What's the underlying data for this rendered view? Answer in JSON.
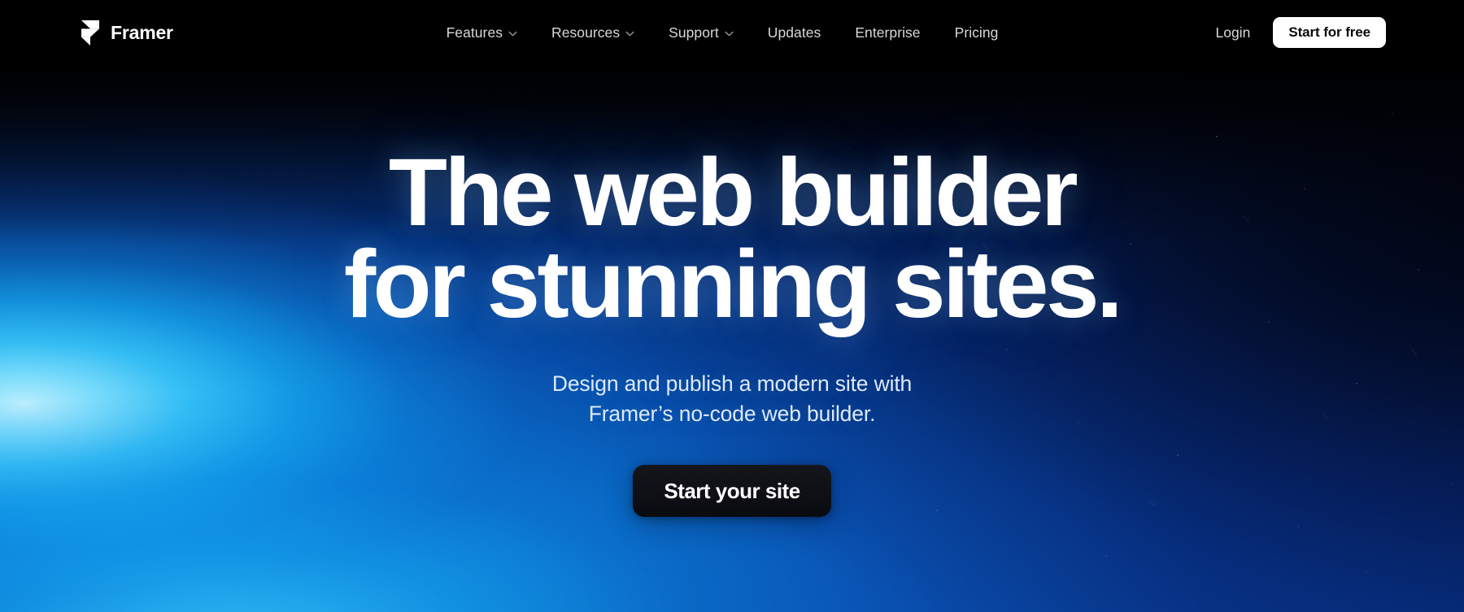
{
  "brand": {
    "name": "Framer",
    "logo_icon": "framer-logo-icon"
  },
  "nav": {
    "items": [
      {
        "label": "Features",
        "has_dropdown": true,
        "icon": "chevron-down-icon"
      },
      {
        "label": "Resources",
        "has_dropdown": true,
        "icon": "chevron-down-icon"
      },
      {
        "label": "Support",
        "has_dropdown": true,
        "icon": "chevron-down-icon"
      },
      {
        "label": "Updates",
        "has_dropdown": false,
        "icon": ""
      },
      {
        "label": "Enterprise",
        "has_dropdown": false,
        "icon": ""
      },
      {
        "label": "Pricing",
        "has_dropdown": false,
        "icon": ""
      }
    ],
    "login_label": "Login",
    "cta_label": "Start for free"
  },
  "hero": {
    "title_line_1": "The web builder",
    "title_line_2": "for stunning sites.",
    "subtitle_line_1": "Design and publish a modern site with",
    "subtitle_line_2": "Framer’s no-code web builder.",
    "cta_label": "Start your site"
  },
  "colors": {
    "nav_background": "#000000",
    "nav_text": "#d6d8dc",
    "nav_cta_background": "#ffffff",
    "nav_cta_text": "#0a0a0a",
    "hero_title": "#ffffff",
    "hero_subtitle": "#dce9f7",
    "hero_cta_background": "#0d0e13",
    "hero_cta_text": "#ffffff",
    "gradient_cyan": "#3accfd",
    "gradient_blue": "#0a60c8",
    "gradient_navy": "#031026",
    "gradient_black": "#000000"
  }
}
